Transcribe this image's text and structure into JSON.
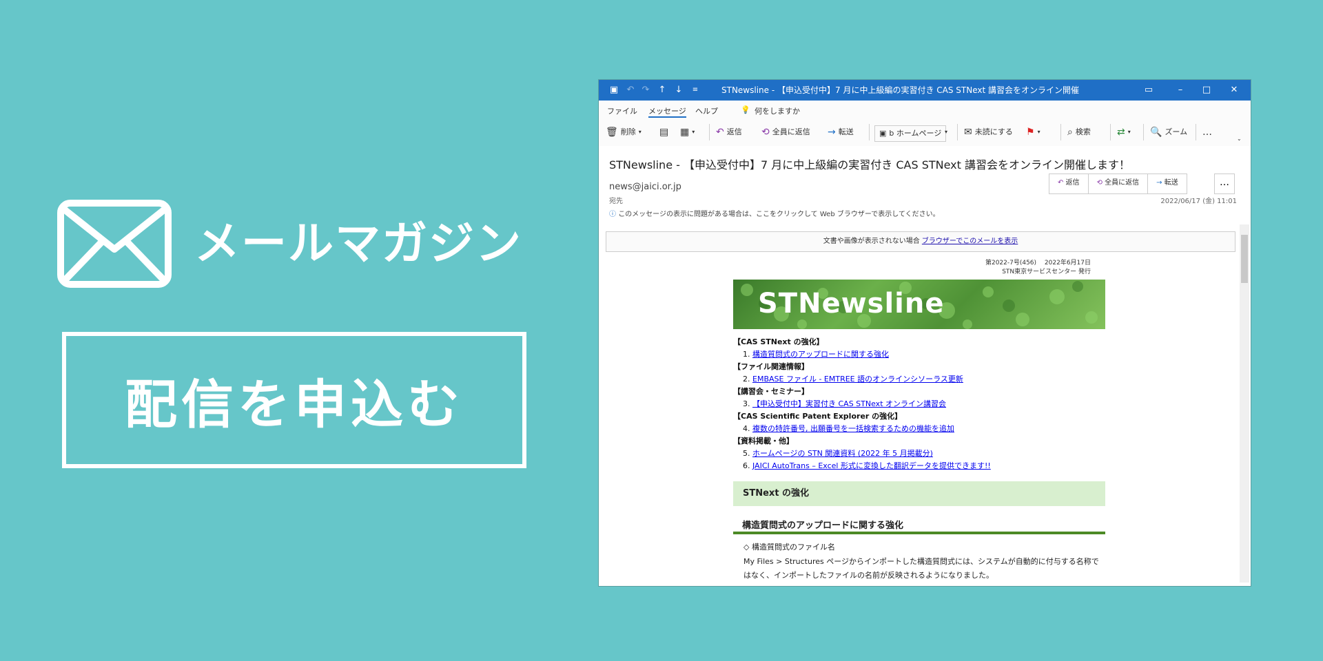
{
  "promo": {
    "title": "メールマガジン",
    "button_label": "配信を申込む"
  },
  "window": {
    "title": "STNewsline - 【申込受付中】7 月に中上級編の実習付き CAS STNext 講習会をオンライン開催します！ - メッセージ (HTML…",
    "menu": [
      "ファイル",
      "メッセージ",
      "ヘルプ",
      "何をしますか"
    ],
    "ribbon": {
      "delete": "削除",
      "reply": "返信",
      "reply_all": "全員に返信",
      "forward": "転送",
      "homepage": "b ホームページ",
      "mark_unread": "未読にする",
      "search": "検索",
      "zoom": "ズーム",
      "more": "…"
    }
  },
  "message": {
    "subject": "STNewsline - 【申込受付中】7 月に中上級編の実習付き CAS STNext 講習会をオンライン開催します！",
    "sender": "news@jaici.or.jp",
    "to_label": "宛先",
    "date": "2022/06/17 (金) 11:01",
    "reply_buttons": [
      "返信",
      "全員に返信",
      "転送"
    ],
    "more": "…",
    "info_line": "このメッセージの表示に問題がある場合は、ここをクリックして Web ブラウザーで表示してください。",
    "browser_notice_prefix": "文書や画像が表示されない場合",
    "browser_notice_link": "ブラウザーでこのメールを表示"
  },
  "newsletter": {
    "issue_line1": "第2022-7号(456)　 2022年6月17日",
    "issue_line2": "STN東京サービスセンター 発行",
    "banner_text": "STNewsline",
    "toc": [
      {
        "category": "【CAS STNext の強化】",
        "items": [
          {
            "num": "1.",
            "text": "構造質問式のアップロードに関する強化"
          }
        ]
      },
      {
        "category": "【ファイル関連情報】",
        "items": [
          {
            "num": "2.",
            "text": "EMBASE ファイル - EMTREE 語のオンラインシソーラス更新"
          }
        ]
      },
      {
        "category": "【講習会・セミナー】",
        "items": [
          {
            "num": "3.",
            "text": "【申込受付中】実習付き CAS STNext オンライン講習会"
          }
        ]
      },
      {
        "category": "【CAS Scientific Patent Explorer の強化】",
        "items": [
          {
            "num": "4.",
            "text": "複数の特許番号, 出願番号を一括検索するための機能を追加"
          }
        ]
      },
      {
        "category": "【資料掲載・他】",
        "items": [
          {
            "num": "5.",
            "text": "ホームページの STN 関連資料 (2022 年 5 月掲載分)"
          },
          {
            "num": "6.",
            "text": "JAICI AutoTrans – Excel 形式に変換した翻訳データを提供できます!!"
          }
        ]
      }
    ],
    "section_head": "STNext の強化",
    "article_title": "構造質問式のアップロードに関する強化",
    "article_sub": "◇ 構造質問式のファイル名",
    "article_text": "My Files > Structures ページからインポートした構造質問式には、システムが自動的に付与する名称ではなく、インポートしたファイルの名前が反映されるようになりました。"
  }
}
